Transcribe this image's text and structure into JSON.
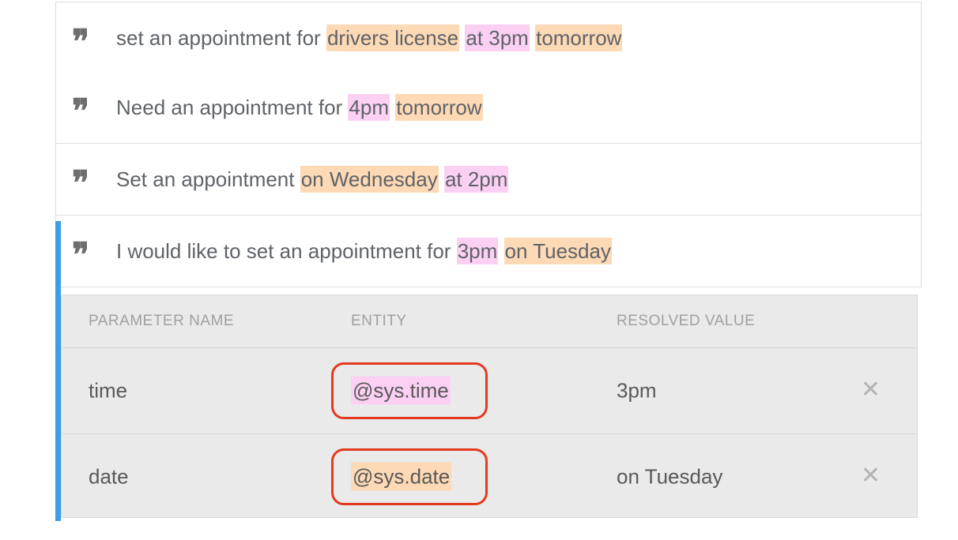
{
  "phrases": [
    {
      "segments": [
        {
          "text": "set an appointment for ",
          "hl": ""
        },
        {
          "text": "drivers license",
          "hl": "orange"
        },
        {
          "text": " ",
          "hl": ""
        },
        {
          "text": "at 3pm",
          "hl": "pink"
        },
        {
          "text": " ",
          "hl": ""
        },
        {
          "text": "tomorrow",
          "hl": "orange"
        }
      ]
    },
    {
      "segments": [
        {
          "text": "Need an appointment for ",
          "hl": ""
        },
        {
          "text": "4pm",
          "hl": "pink"
        },
        {
          "text": " ",
          "hl": ""
        },
        {
          "text": "tomorrow",
          "hl": "orange"
        }
      ]
    },
    {
      "segments": [
        {
          "text": "Set an appointment ",
          "hl": ""
        },
        {
          "text": "on Wednesday",
          "hl": "orange"
        },
        {
          "text": " ",
          "hl": ""
        },
        {
          "text": "at 2pm",
          "hl": "pink"
        }
      ]
    },
    {
      "segments": [
        {
          "text": "I would like to set an appointment for ",
          "hl": ""
        },
        {
          "text": "3pm",
          "hl": "pink"
        },
        {
          "text": " ",
          "hl": ""
        },
        {
          "text": "on Tuesday",
          "hl": "orange"
        }
      ]
    }
  ],
  "quote_icon": "quote-icon",
  "table": {
    "headers": {
      "parameter_name": "PARAMETER NAME",
      "entity": "ENTITY",
      "resolved_value": "RESOLVED VALUE"
    },
    "rows": [
      {
        "name": "time",
        "entity": "@sys.time",
        "entity_color": "#fbd0f3",
        "value": "3pm"
      },
      {
        "name": "date",
        "entity": "@sys.date",
        "entity_color": "#fdd9b5",
        "value": "on Tuesday"
      }
    ],
    "delete_symbol": "✕"
  },
  "colors": {
    "highlight_orange": "#fdd9b5",
    "highlight_pink": "#fbd0f3",
    "active_bar": "#3d9ee6",
    "annotation_ring": "#e23a1e"
  }
}
